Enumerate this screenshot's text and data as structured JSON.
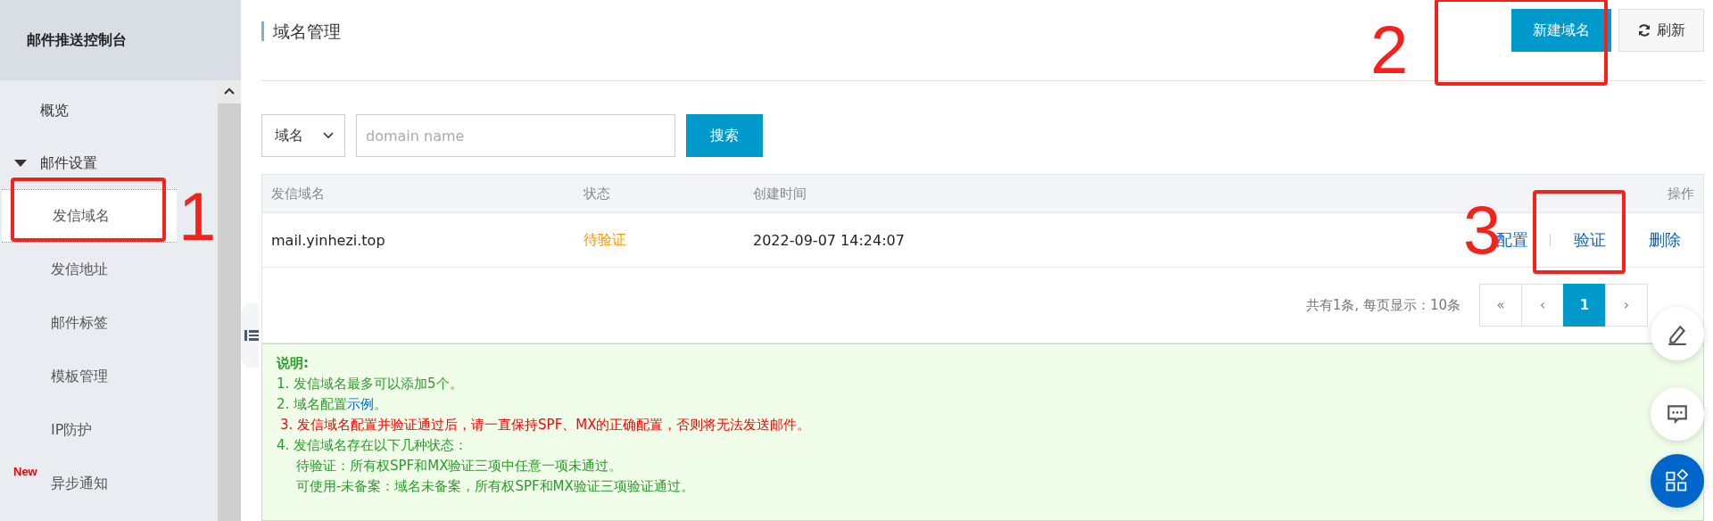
{
  "sidebar": {
    "title": "邮件推送控制台",
    "items": [
      {
        "label": "概览",
        "kind": "item",
        "selected": false
      },
      {
        "label": "邮件设置",
        "kind": "group",
        "expanded": true,
        "children": [
          {
            "label": "发信域名",
            "selected": true
          },
          {
            "label": "发信地址",
            "selected": false
          },
          {
            "label": "邮件标签",
            "selected": false
          },
          {
            "label": "模板管理",
            "selected": false
          },
          {
            "label": "IP防护",
            "selected": false
          },
          {
            "label": "异步通知",
            "selected": false,
            "badge": "New"
          }
        ]
      }
    ]
  },
  "page": {
    "title": "域名管理",
    "buttons": [
      {
        "label": "新建域名",
        "kind": "primary"
      },
      {
        "label": "刷新",
        "kind": "refresh"
      }
    ]
  },
  "search": {
    "field": "域名",
    "placeholder": "domain name",
    "button": "搜索"
  },
  "table": {
    "columns": [
      "发信域名",
      "状态",
      "创建时间",
      "操作"
    ],
    "rows": [
      {
        "domain": "mail.yinhezi.top",
        "status": "待验证",
        "color": "#ff9900",
        "created": "2022-09-07 14:24:07",
        "actions": [
          "配置",
          "验证",
          "删除"
        ]
      }
    ]
  },
  "pagination": {
    "summary": "共有1条, 每页显示：10条",
    "pages": [
      {
        "label": "«",
        "kind": "nav",
        "selected": false
      },
      {
        "label": "‹",
        "kind": "nav",
        "selected": false
      },
      {
        "label": "1",
        "kind": "page",
        "selected": true
      },
      {
        "label": "›",
        "kind": "nav",
        "selected": false
      }
    ]
  },
  "notes": {
    "title": "说明:",
    "lines": [
      {
        "kind": "normal",
        "parts": [
          {
            "text": "1. 发信域名最多可以添加5个。"
          }
        ]
      },
      {
        "kind": "normal",
        "parts": [
          {
            "text": "2. 域名配置"
          },
          {
            "text": "示例",
            "link": true
          },
          {
            "text": "。"
          }
        ]
      },
      {
        "kind": "warning",
        "parts": [
          {
            "text": "3. 发信域名配置并验证通过后，请一直保持SPF、MX的正确配置，否则将无法发送邮件。"
          }
        ]
      },
      {
        "kind": "normal",
        "parts": [
          {
            "text": "4. 发信域名存在以下几种状态："
          }
        ]
      },
      {
        "kind": "sub",
        "parts": [
          {
            "text": "待验证：所有权SPF和MX验证三项中任意一项未通过。"
          }
        ]
      },
      {
        "kind": "sub",
        "parts": [
          {
            "text": "可使用-未备案：域名未备案，所有权SPF和MX验证三项验证通过。"
          }
        ]
      }
    ]
  },
  "annotations": [
    {
      "label": "1"
    },
    {
      "label": "2"
    },
    {
      "label": "3"
    }
  ]
}
